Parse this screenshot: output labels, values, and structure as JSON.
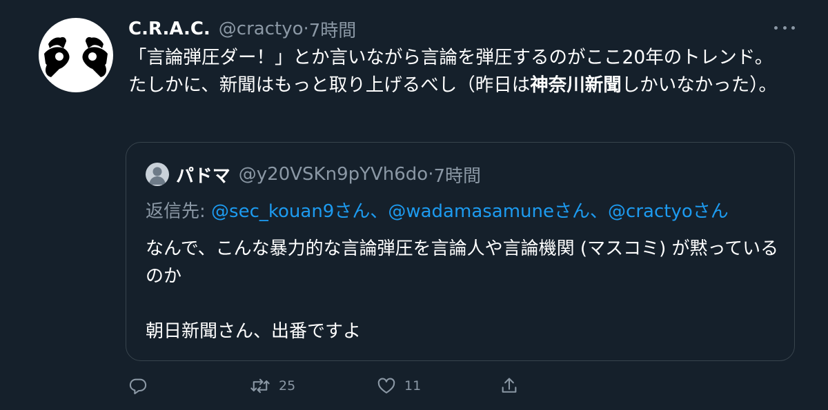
{
  "tweet": {
    "display_name": "C.R.A.C.",
    "handle": "@cractyo",
    "separator": "·",
    "time": "7時間",
    "text_part1": "「言論弾圧ダー！」とか言いながら言論を弾圧するのがここ20年のトレンド。たしかに、新聞はもっと取り上げるべし（昨日は",
    "text_bold": "神奈川新聞",
    "text_part2": "しかいなかった）。"
  },
  "quote": {
    "display_name": "パドマ",
    "handle": "@y20VSKn9pYVh6do",
    "separator": "·",
    "time": "7時間",
    "reply_label": "返信先: ",
    "mentions": [
      "@sec_kouan9",
      "@wadamasamune",
      "@cractyo"
    ],
    "mention_suffixes": [
      "さん、",
      "さん、",
      "さん"
    ],
    "body_line1": "なんで、こんな暴力的な言論弾圧を言論人や言論機関 (マスコミ) が黙っているのか",
    "body_line2": "朝日新聞さん、出番ですよ"
  },
  "actions": {
    "reply_count": "",
    "retweet_count": "25",
    "like_count": "11"
  },
  "icons": {
    "more": "more-horizontal-icon",
    "reply": "reply-icon",
    "retweet": "retweet-icon",
    "like": "heart-icon",
    "share": "share-icon"
  },
  "colors": {
    "background": "#15202b",
    "secondary_text": "#8b98a5",
    "link": "#1d9bf0",
    "border": "#38444d"
  }
}
